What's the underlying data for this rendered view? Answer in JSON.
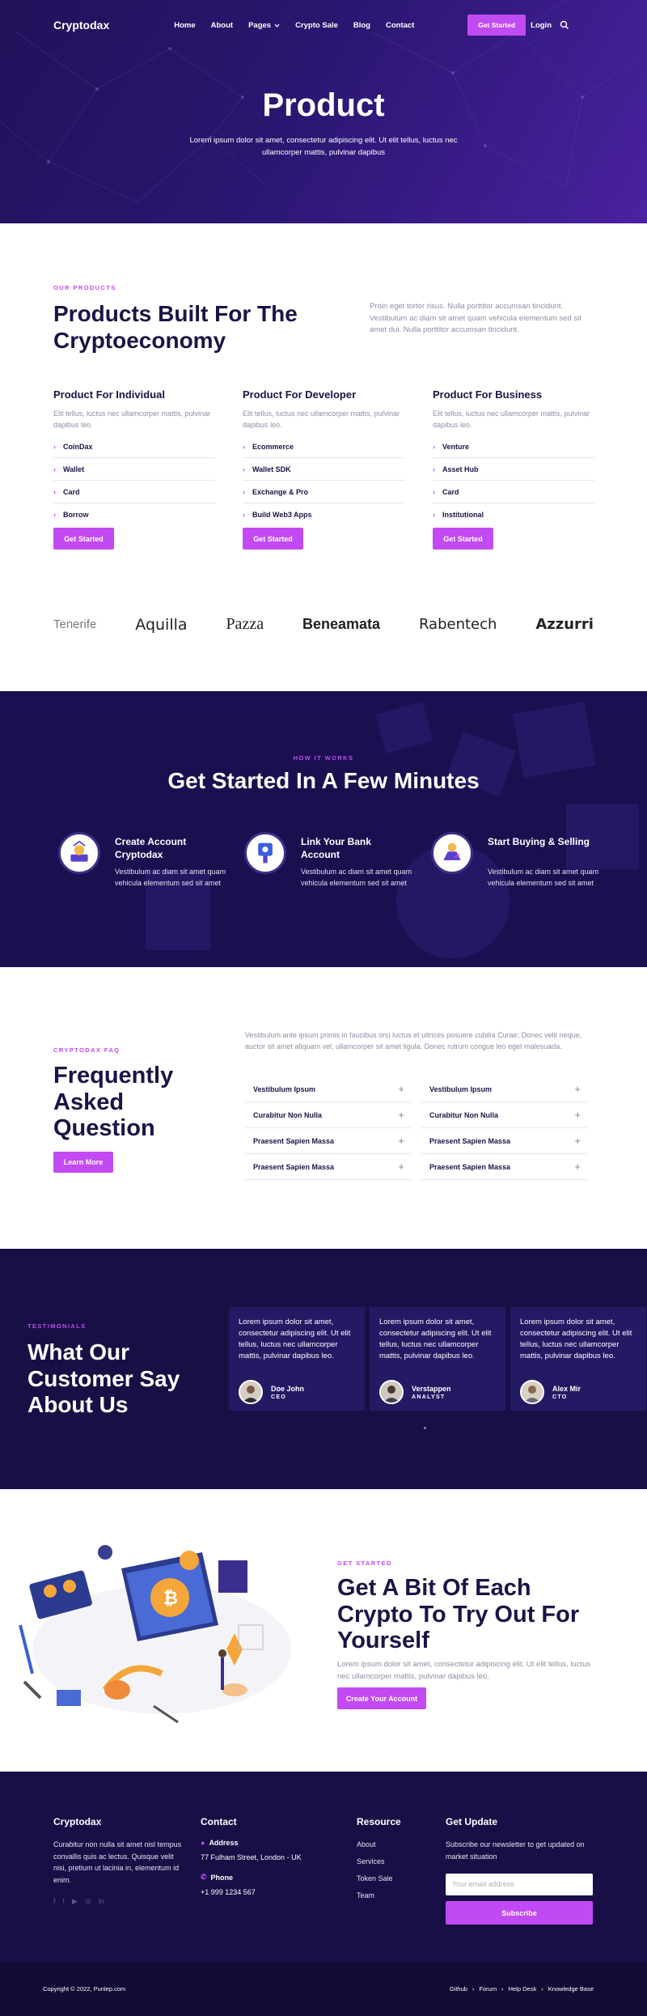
{
  "brand": "Cryptodax",
  "nav": {
    "items": [
      "Home",
      "About",
      "Pages",
      "Crypto Sale",
      "Blog",
      "Contact"
    ],
    "cta": "Get Started",
    "login": "Login"
  },
  "hero": {
    "title": "Product",
    "subtitle": "Lorem ipsum dolor sit amet, consectetur adipiscing elit. Ut elit tellus, luctus nec ullamcorper mattis, pulvinar dapibus"
  },
  "products": {
    "kicker": "OUR PRODUCTS",
    "title": "Products Built For The Cryptoeconomy",
    "lead": "Proin eget tortor risus. Nulla porttitor accumsan tincidunt. Vestibulum ac diam sit amet quam vehicula elementum sed sit amet dui. Nulla porttitor accumsan tincidunt.",
    "columns": [
      {
        "title": "Product For Individual",
        "desc": "Elit tellus, luctus nec ullamcorper mattis, pulvinar dapibus leo.",
        "items": [
          "CoinDax",
          "Wallet",
          "Card",
          "Borrow"
        ],
        "button": "Get Started"
      },
      {
        "title": "Product For Developer",
        "desc": "Elit tellus, luctus nec ullamcorper mattis, pulvinar dapibus leo.",
        "items": [
          "Ecommerce",
          "Wallet SDK",
          "Exchange & Pro",
          "Build Web3 Apps"
        ],
        "button": "Get Started"
      },
      {
        "title": "Product For Business",
        "desc": "Elit tellus, luctus nec ullamcorper mattis, pulvinar dapibus leo.",
        "items": [
          "Venture",
          "Asset Hub",
          "Card",
          "Institutional"
        ],
        "button": "Get Started"
      }
    ],
    "brands": [
      "Tenerife",
      "Aquilla",
      "Pazza",
      "Beneamata",
      "Rabentech",
      "Azzurri"
    ]
  },
  "how": {
    "kicker": "HOW IT WORKS",
    "title": "Get Started In A Few Minutes",
    "steps": [
      {
        "title": "Create Account Cryptodax",
        "desc": "Vestibulum ac diam sit amet quam vehicula elementum sed sit amet"
      },
      {
        "title": "Link Your Bank Account",
        "desc": "Vestibulum ac diam sit amet quam vehicula elementum sed sit amet"
      },
      {
        "title": "Start Buying & Selling",
        "desc": "Vestibulum ac diam sit amet quam vehicula elementum sed sit amet"
      }
    ]
  },
  "faq": {
    "kicker": "CRYPTODAX FAQ",
    "title": "Frequently Asked Question",
    "button": "Learn More",
    "lead": "Vestibulum ante ipsum primis in faucibus orci luctus et ultrices posuere cubilia Curae; Donec velit neque, auctor sit amet aliquam vel, ullamcorper sit amet ligula. Donec rutrum congue leo eget malesuada.",
    "left": [
      "Vestibulum Ipsum",
      "Curabitur Non Nulla",
      "Praesent Sapien Massa",
      "Praesent Sapien Massa"
    ],
    "right": [
      "Vestibulum Ipsum",
      "Curabitur Non Nulla",
      "Praesent Sapien Massa",
      "Praesent Sapien Massa"
    ]
  },
  "testimonials": {
    "kicker": "TESTIMONIALS",
    "title": "What Our Customer Say About Us",
    "cards": [
      {
        "text": "Lorem ipsum dolor sit amet, consectetur adipiscing elit. Ut elit tellus, luctus nec ullamcorper mattis, pulvinar dapibus leo.",
        "name": "Doe John",
        "role": "CEO"
      },
      {
        "text": "Lorem ipsum dolor sit amet, consectetur adipiscing elit. Ut elit tellus, luctus nec ullamcorper mattis, pulvinar dapibus leo.",
        "name": "Verstappen",
        "role": "ANALYST"
      },
      {
        "text": "Lorem ipsum dolor sit amet, consectetur adipiscing elit. Ut elit tellus, luctus nec ullamcorper mattis, pulvinar dapibus leo.",
        "name": "Alex Mir",
        "role": "CTO"
      }
    ]
  },
  "cta": {
    "kicker": "GET STARTED",
    "title": "Get A Bit Of Each Crypto To Try Out For Yourself",
    "desc": "Lorem ipsum dolor sit amet, consectetur adipiscing elit. Ut elit tellus, luctus nec ullamcorper mattis, pulvinar dapibus leo.",
    "button": "Create Your Account"
  },
  "footer": {
    "about": {
      "title": "Cryptodax",
      "text": "Curabitur non nulla sit amet nisl tempus convallis quis ac lectus. Quisque velit nisi, pretium ut lacinia in, elementum id enim."
    },
    "contact": {
      "title": "Contact",
      "address_label": "Address",
      "address": "77 Fulham Street, London - UK",
      "phone_label": "Phone",
      "phone": "+1 999 1234 567"
    },
    "resource": {
      "title": "Resource",
      "items": [
        "About",
        "Services",
        "Token Sale",
        "Team"
      ]
    },
    "update": {
      "title": "Get Update",
      "text": "Subscribe our newsletter to get updated on market situation",
      "placeholder": "Your email address",
      "button": "Subscribe"
    },
    "copyright": "Copyright © 2022, Punlep.com",
    "links": [
      "Github",
      "Forum",
      "Help Desk",
      "Knowledge Base"
    ]
  },
  "colors": {
    "accent": "#c24af2",
    "navy": "#1b1447",
    "dark_bg": "#171045"
  }
}
